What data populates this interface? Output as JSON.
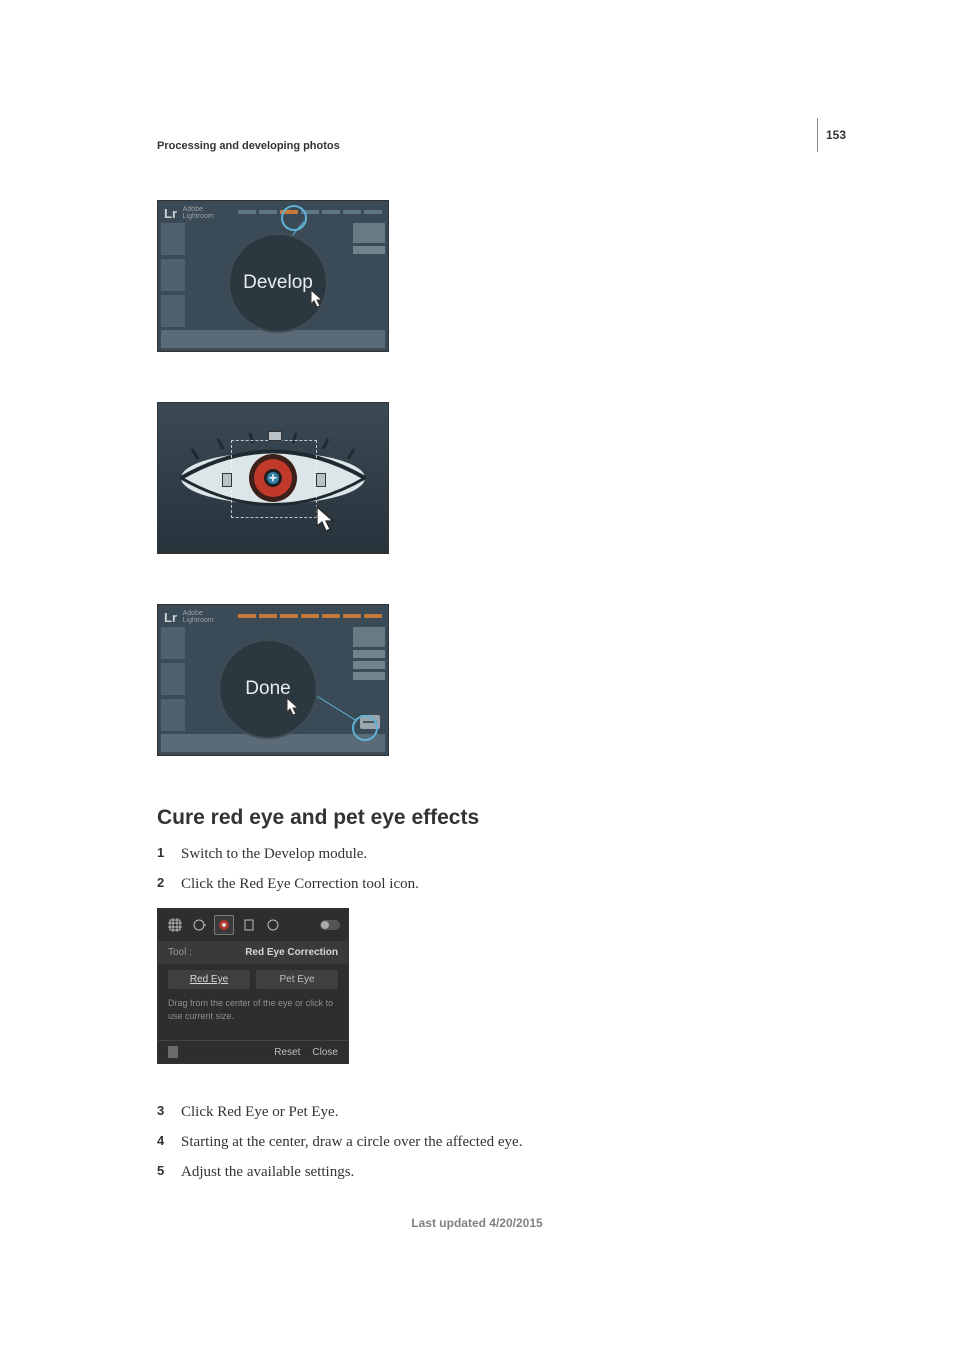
{
  "page_number": "153",
  "running_head": "Processing and developing photos",
  "figures": {
    "fig1": {
      "app_label_bold": "Lr",
      "app_label_small_line1": "Adobe",
      "app_label_small_line2": "Lightroom",
      "circle_label": "Develop"
    },
    "fig3": {
      "app_label_bold": "Lr",
      "app_label_small_line1": "Adobe",
      "app_label_small_line2": "Lightroom",
      "circle_label": "Done"
    }
  },
  "heading": "Cure red eye and pet eye effects",
  "steps_a": [
    "Switch to the Develop module.",
    "Click the Red Eye Correction tool icon."
  ],
  "tool_panel": {
    "tool_label": "Tool :",
    "title": "Red Eye Correction",
    "tab_red": "Red Eye",
    "tab_pet": "Pet Eye",
    "hint": "Drag from the center of the eye or click to use current size.",
    "reset": "Reset",
    "close": "Close"
  },
  "steps_b": [
    "Click Red Eye or Pet Eye.",
    "Starting at the center, draw a circle over the affected eye.",
    "Adjust the available settings."
  ],
  "footer": "Last updated 4/20/2015"
}
